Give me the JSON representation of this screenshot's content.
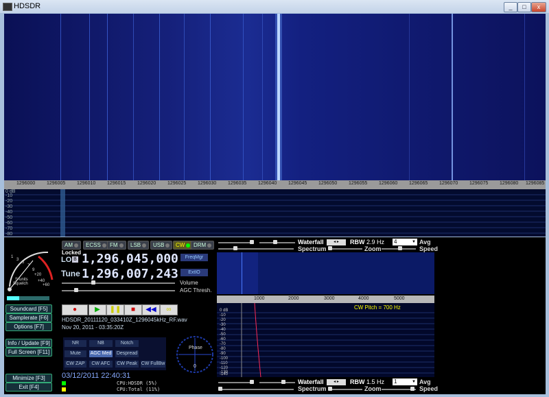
{
  "window": {
    "title": "HDSDR",
    "min": "_",
    "max": "□",
    "close": "x"
  },
  "freq_axis": [
    "1296000",
    "1296005",
    "1296010",
    "1296015",
    "1296020",
    "1296025",
    "1296030",
    "1296035",
    "1296040",
    "1296045",
    "1296050",
    "1296055",
    "1296060",
    "1296065",
    "1296070",
    "1296075",
    "1296080",
    "1296085"
  ],
  "spectrum": {
    "db_labels": [
      "0 dB",
      "-10",
      "-20",
      "-30",
      "-40",
      "-50",
      "-60",
      "-70",
      "-80"
    ]
  },
  "smeter": {
    "scale": [
      "1",
      "3",
      "5",
      "7",
      "9",
      "+20",
      "+40",
      "+60"
    ],
    "label": "S-units",
    "squelch": "Squelch"
  },
  "modes": [
    {
      "label": "AM"
    },
    {
      "label": "ECSS"
    },
    {
      "label": "FM"
    },
    {
      "label": "LSB"
    },
    {
      "label": "USB"
    },
    {
      "label": "CW"
    },
    {
      "label": "DRM"
    }
  ],
  "lo": {
    "state": "Locked",
    "label": "LO",
    "b": "B",
    "freq": "1,296,045,000"
  },
  "tune": {
    "label": "Tune",
    "freq": "1,296,007,243"
  },
  "buttons": {
    "freqmgr": "FreqMgr",
    "extio": "ExtIO",
    "volume": "Volume",
    "agc_thresh": "AGC Thresh."
  },
  "side_buttons": [
    {
      "label": "Soundcard",
      "key": "[F5]"
    },
    {
      "label": "Samplerate",
      "key": "[F6]"
    },
    {
      "label": "Options",
      "key": "[F7]"
    },
    {
      "label": "Info / Update",
      "key": "[F9]"
    },
    {
      "label": "Full Screen",
      "key": "[F11]"
    },
    {
      "label": "Minimize",
      "key": "[F3]"
    },
    {
      "label": "Exit",
      "key": "[F4]"
    }
  ],
  "recording": {
    "file": "HDSDR_20111120_033410Z_1296045kHz_RF.wav",
    "date": "Nov 20, 2011 - 03:35:20Z"
  },
  "dsp": [
    {
      "label": "NR",
      "active": false
    },
    {
      "label": "NB",
      "active": false
    },
    {
      "label": "Notch",
      "active": false
    },
    {
      "label": "Mute",
      "active": false
    },
    {
      "label": "AGC Med",
      "active": true
    },
    {
      "label": "Despread",
      "active": false
    },
    {
      "label": "CW ZAP",
      "active": false
    },
    {
      "label": "CW AFC",
      "active": false
    },
    {
      "label": "CW Peak",
      "active": false
    },
    {
      "label": "CW FullBw",
      "active": false
    }
  ],
  "phase": {
    "label": "Phase",
    "zero": "0"
  },
  "clock": "03/12/2011 22:40:31",
  "cpu": {
    "hdsdr": "CPU:HDSDR (5%)",
    "total": "CPU:Total (11%)"
  },
  "top_controls": {
    "waterfall": "Waterfall",
    "rbw_label": "RBW",
    "rbw": "2.9 Hz",
    "avg_value": "4",
    "avg": "Avg",
    "spectrum": "Spectrum",
    "zoom": "Zoom",
    "speed": "Speed"
  },
  "bottom_controls": {
    "waterfall": "Waterfall",
    "rbw_label": "RBW",
    "rbw": "1.5 Hz",
    "avg_value": "1",
    "avg": "Avg",
    "spectrum": "Spectrum",
    "zoom": "Zoom",
    "speed": "Speed"
  },
  "zoom_axis": [
    "1000",
    "2000",
    "3000",
    "4000",
    "5000"
  ],
  "zoom_db": [
    "0 dB",
    "-10",
    "-20",
    "-30",
    "-40",
    "-50",
    "-60",
    "-70",
    "-80",
    "-90",
    "-100",
    "-110",
    "-120",
    "-130",
    "-140"
  ],
  "cw_pitch": "CW Pitch = 700 Hz"
}
